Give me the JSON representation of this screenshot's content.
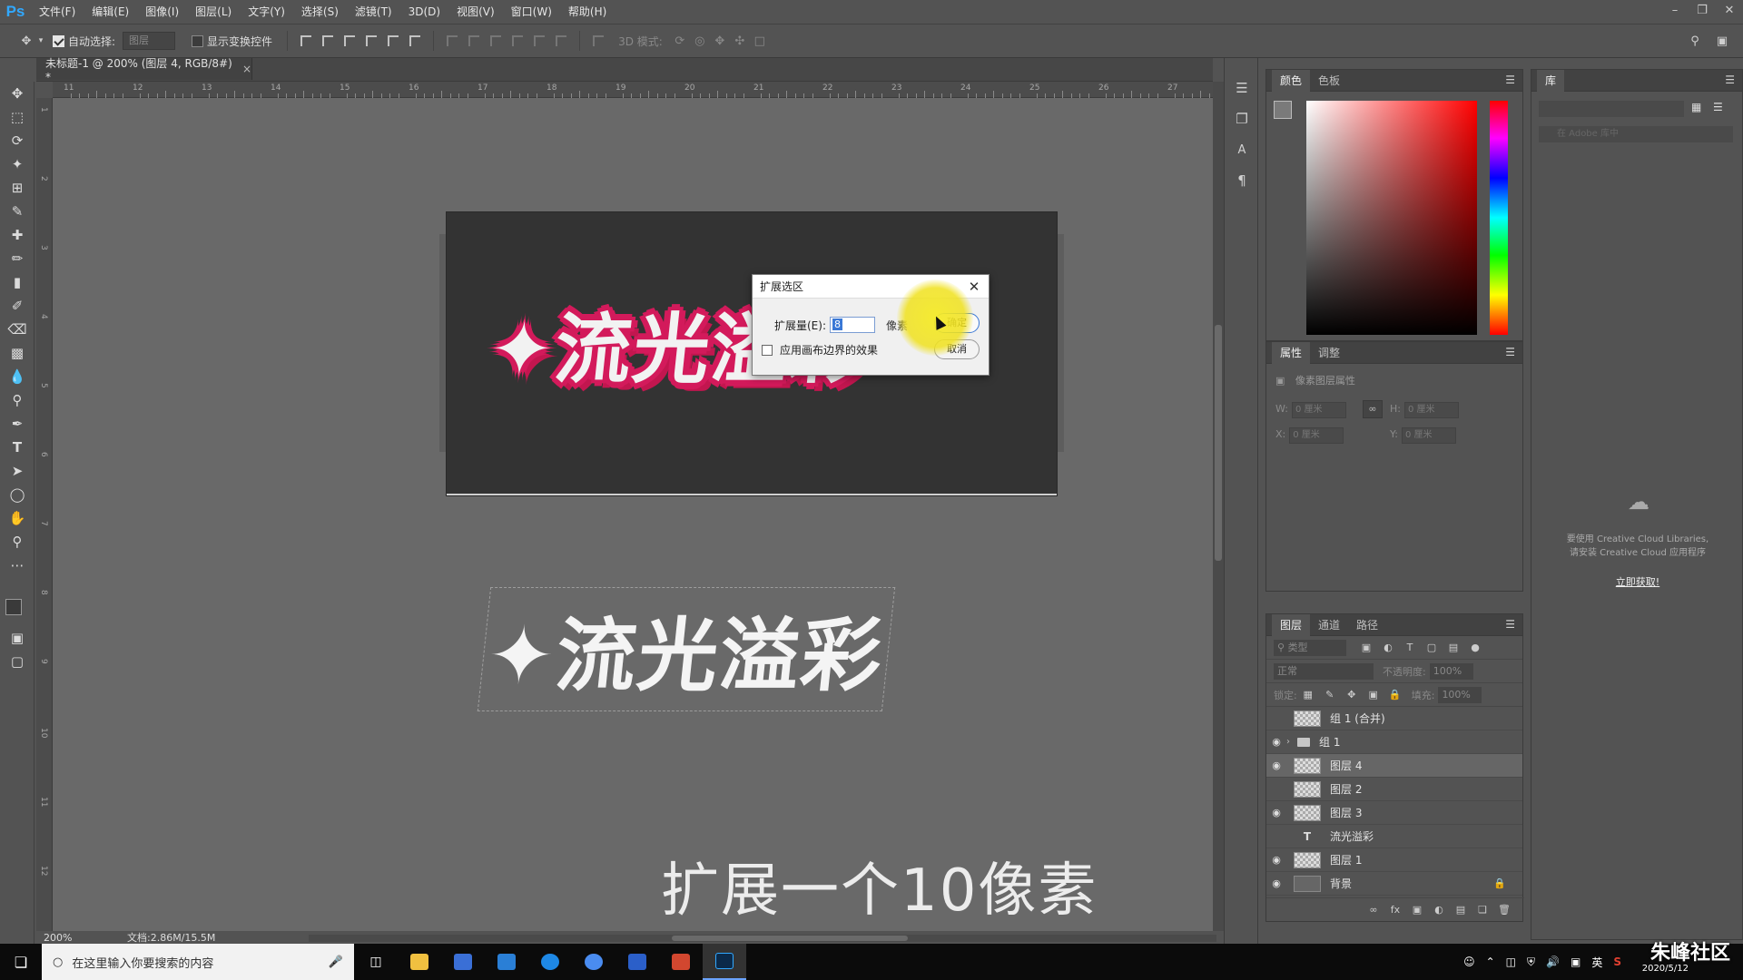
{
  "app": {
    "logo": "Ps",
    "menu": [
      "文件(F)",
      "编辑(E)",
      "图像(I)",
      "图层(L)",
      "文字(Y)",
      "选择(S)",
      "滤镜(T)",
      "3D(D)",
      "视图(V)",
      "窗口(W)",
      "帮助(H)"
    ]
  },
  "options": {
    "auto_select_label": "自动选择:",
    "auto_select_value": "图层",
    "show_transform_label": "显示变换控件",
    "mode_3d_label": "3D 模式:"
  },
  "document": {
    "tab_title": "未标题-1 @ 200% (图层 4, RGB/8#) *",
    "zoom": "200%",
    "doc_size": "文档:2.86M/15.5M",
    "ruler_top_ticks": [
      "11",
      "12",
      "13",
      "14",
      "15",
      "16",
      "17",
      "18",
      "19",
      "20",
      "21",
      "22",
      "23",
      "24",
      "25",
      "26",
      "27"
    ],
    "ruler_left_ticks": [
      "1",
      "2",
      "3",
      "4",
      "5",
      "6",
      "7",
      "8",
      "9",
      "10",
      "11",
      "12"
    ]
  },
  "artwork": {
    "text_pink": "✦流光溢彩",
    "text_white": "✦流光溢彩"
  },
  "subtitle": "扩展一个10像素",
  "dialog": {
    "title": "扩展选区",
    "expand_label": "扩展量(E):",
    "expand_value": "8",
    "unit": "像素",
    "checkbox_label": "应用画布边界的效果",
    "ok_label": "确定",
    "cancel_label": "取消"
  },
  "color_panel": {
    "tabs": [
      "颜色",
      "色板"
    ],
    "fg_color": "#7a7a7a",
    "bg_color": "#d86a3a"
  },
  "properties_panel": {
    "tabs": [
      "属性",
      "调整"
    ],
    "header": "像素图层属性",
    "w_label": "W:",
    "h_label": "H:",
    "x_label": "X:",
    "y_label": "Y:",
    "w_value": "0 厘米",
    "h_value": "0 厘米",
    "x_value": "0 厘米",
    "y_value": "0 厘米"
  },
  "layers_panel": {
    "tabs": [
      "图层",
      "通道",
      "路径"
    ],
    "search_placeholder": "类型",
    "blend_mode": "正常",
    "opacity_label": "不透明度:",
    "opacity_value": "100%",
    "lock_label": "锁定:",
    "fill_label": "填充:",
    "fill_value": "100%",
    "layers": [
      {
        "name": "组 1 (合并)",
        "visible": false,
        "kind": "pixel"
      },
      {
        "name": "组 1",
        "visible": true,
        "kind": "group"
      },
      {
        "name": "图层 4",
        "visible": true,
        "kind": "pixel",
        "selected": true
      },
      {
        "name": "图层 2",
        "visible": false,
        "kind": "pixel"
      },
      {
        "name": "图层 3",
        "visible": true,
        "kind": "pixel"
      },
      {
        "name": "流光溢彩",
        "visible": false,
        "kind": "text"
      },
      {
        "name": "图层 1",
        "visible": true,
        "kind": "pixel"
      },
      {
        "name": "背景",
        "visible": true,
        "kind": "background"
      }
    ]
  },
  "library_panel": {
    "tab": "库",
    "search_placeholder": "在 Adobe 库中",
    "message_line1": "要使用 Creative Cloud Libraries,",
    "message_line2": "请安装 Creative Cloud 应用程序",
    "link": "立即获取!"
  },
  "taskbar": {
    "search_placeholder": "在这里输入你要搜索的内容",
    "ime": "英"
  },
  "watermark": {
    "brand": "朱峰社区",
    "date": "2020/5/12"
  }
}
